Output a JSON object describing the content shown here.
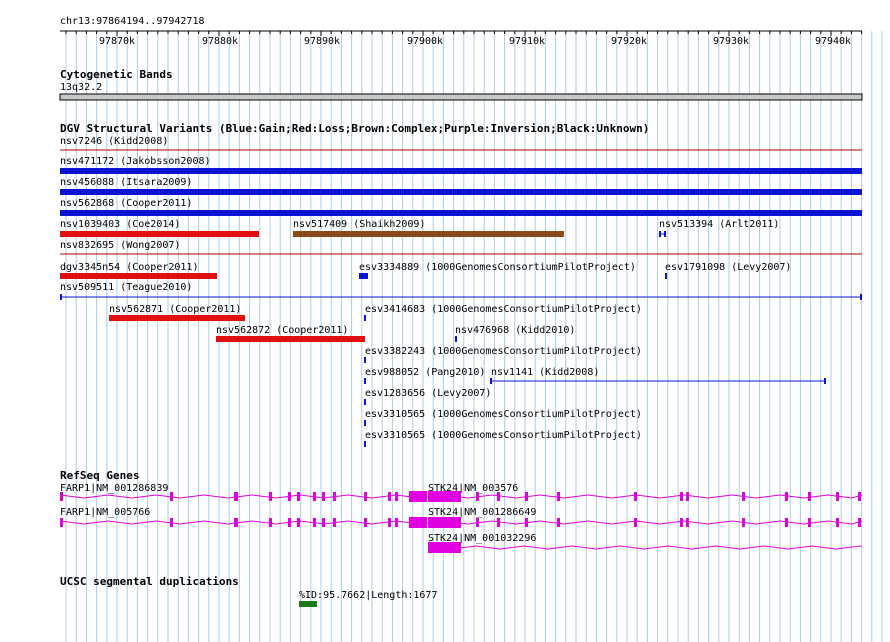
{
  "ruler": {
    "coordinates": "chr13:97864194..97942718",
    "ticks": [
      "97870k",
      "97880k",
      "97890k",
      "97900k",
      "97910k",
      "97920k",
      "97930k",
      "97940k"
    ]
  },
  "cytoband": {
    "title": "Cytogenetic Bands",
    "band": "13q32.2"
  },
  "dgv": {
    "title": "DGV Structural Variants (Blue:Gain;Red:Loss;Brown:Complex;Purple:Inversion;Black:Unknown)",
    "colors": {
      "gain": "#0a14d2",
      "loss": "#e01010",
      "complex": "#8b4a18",
      "divider": "#b00000"
    },
    "features": [
      {
        "label": "nsv7246 (Kidd2008)"
      },
      {
        "label": "nsv471172 (Jakobsson2008)"
      },
      {
        "label": "nsv456088 (Itsara2009)"
      },
      {
        "label": "nsv562868 (Cooper2011)"
      },
      {
        "label": "nsv1039403 (Coe2014)"
      },
      {
        "label": "nsv517409 (Shaikh2009)"
      },
      {
        "label": "nsv513394 (Arlt2011)"
      },
      {
        "label": "nsv832695 (Wong2007)"
      },
      {
        "label": "dgv3345n54 (Cooper2011)"
      },
      {
        "label": "esv3334889 (1000GenomesConsortiumPilotProject)"
      },
      {
        "label": "esv1791098 (Levy2007)"
      },
      {
        "label": "nsv509511 (Teague2010)"
      },
      {
        "label": "nsv562871 (Cooper2011)"
      },
      {
        "label": "esv3414683 (1000GenomesConsortiumPilotProject)"
      },
      {
        "label": "nsv562872 (Cooper2011)"
      },
      {
        "label": "nsv476968 (Kidd2010)"
      },
      {
        "label": "esv3382243 (1000GenomesConsortiumPilotProject)"
      },
      {
        "label": "esv988052 (Pang2010)"
      },
      {
        "label": "nsv1141 (Kidd2008)"
      },
      {
        "label": "esv1283656 (Levy2007)"
      },
      {
        "label": "esv3310565 (1000GenomesConsortiumPilotProject)"
      },
      {
        "label": "esv3310565 (1000GenomesConsortiumPilotProject)"
      }
    ]
  },
  "refseq": {
    "title": "RefSeq Genes",
    "color": "#e000e0",
    "transcripts": [
      {
        "label": "FARP1|NM_001286839"
      },
      {
        "label": "STK24|NM_003576"
      },
      {
        "label": "FARP1|NM_005766"
      },
      {
        "label": "STK24|NM_001286649"
      },
      {
        "label": "STK24|NM_001032296"
      }
    ]
  },
  "segdup": {
    "title": "UCSC segmental duplications",
    "label": "%ID:95.7662|Length:1677",
    "color": "#1a7a1a"
  },
  "grid_color": "#a9cde6"
}
